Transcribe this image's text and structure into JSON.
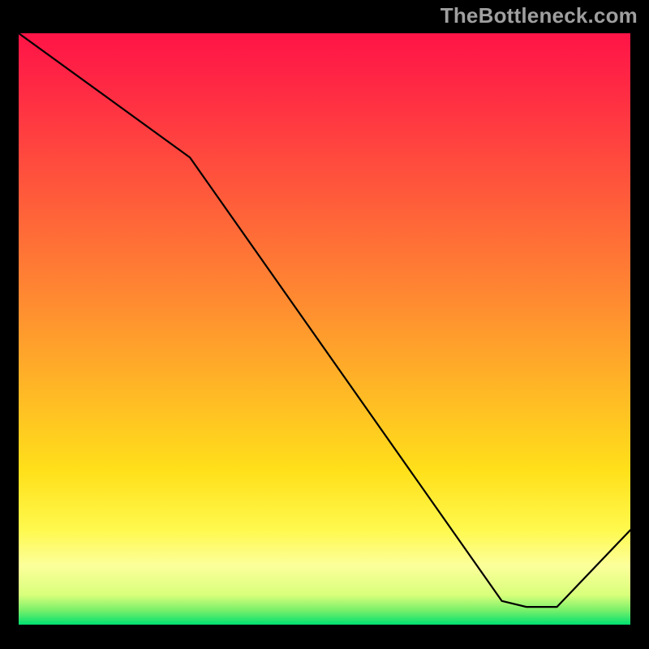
{
  "watermark": "TheBottleneck.com",
  "floor_label": "",
  "chart_data": {
    "type": "line",
    "title": "",
    "xlabel": "",
    "ylabel": "",
    "xlim": [
      0,
      100
    ],
    "ylim": [
      0,
      100
    ],
    "series": [
      {
        "name": "curve",
        "points": [
          {
            "x": 0,
            "y": 100
          },
          {
            "x": 28,
            "y": 79
          },
          {
            "x": 79,
            "y": 4
          },
          {
            "x": 83,
            "y": 3
          },
          {
            "x": 88,
            "y": 3
          },
          {
            "x": 100,
            "y": 16
          }
        ]
      }
    ],
    "gradient_stops": [
      {
        "offset": 0.0,
        "color": "#ff1447"
      },
      {
        "offset": 0.09,
        "color": "#ff2944"
      },
      {
        "offset": 0.27,
        "color": "#ff593b"
      },
      {
        "offset": 0.45,
        "color": "#ff8a31"
      },
      {
        "offset": 0.6,
        "color": "#ffb626"
      },
      {
        "offset": 0.74,
        "color": "#ffe01a"
      },
      {
        "offset": 0.84,
        "color": "#fff94e"
      },
      {
        "offset": 0.9,
        "color": "#fcff9b"
      },
      {
        "offset": 0.95,
        "color": "#d8ff7b"
      },
      {
        "offset": 0.975,
        "color": "#7cf06a"
      },
      {
        "offset": 1.0,
        "color": "#00e070"
      }
    ],
    "floor_label_x": 83
  }
}
